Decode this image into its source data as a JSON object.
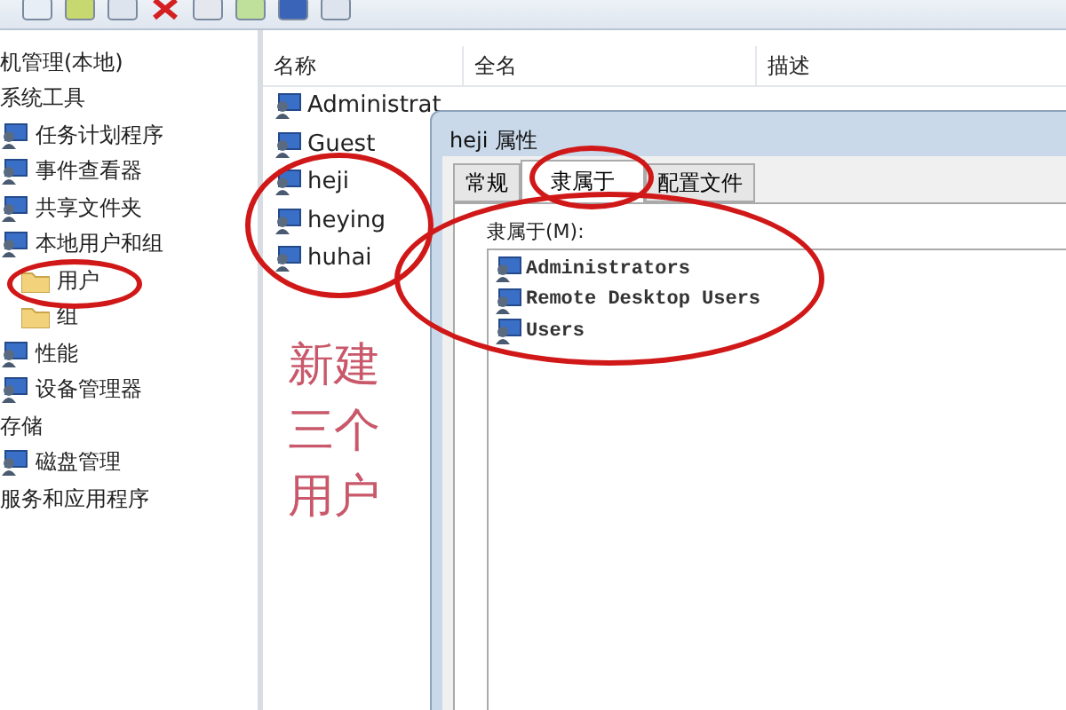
{
  "tree": [
    {
      "label": "机管理(本地)",
      "children": [
        {
          "label": "系统工具",
          "children": [
            {
              "label": "任务计划程序"
            },
            {
              "label": "事件查看器"
            },
            {
              "label": "共享文件夹"
            },
            {
              "label": "本地用户和组",
              "children": [
                {
                  "label": "用户"
                },
                {
                  "label": "组"
                }
              ]
            },
            {
              "label": "性能"
            },
            {
              "label": "设备管理器"
            }
          ]
        },
        {
          "label": "存储",
          "children": [
            {
              "label": "磁盘管理"
            }
          ]
        },
        {
          "label": "服务和应用程序"
        }
      ]
    }
  ],
  "list": {
    "columns": [
      "名称",
      "全名",
      "描述"
    ],
    "rows": [
      {
        "name": "Administrat"
      },
      {
        "name": "Guest"
      },
      {
        "name": "heji"
      },
      {
        "name": "heying"
      },
      {
        "name": "huhai"
      }
    ]
  },
  "dialog": {
    "title": "heji 属性",
    "tabs": [
      {
        "label": "常规",
        "selected": false
      },
      {
        "label": "隶属于",
        "selected": true
      },
      {
        "label": "配置文件",
        "selected": false
      }
    ],
    "member_label": "隶属于(M):",
    "members": [
      "Administrators",
      "Remote Desktop Users",
      "Users"
    ]
  },
  "annotation": {
    "note": "新建三个用户"
  }
}
